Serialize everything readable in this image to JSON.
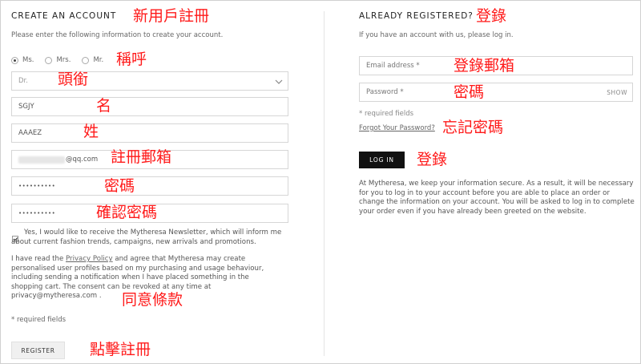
{
  "create": {
    "title": "CREATE AN ACCOUNT",
    "intro": "Please enter the following information to create your account.",
    "salutations": [
      {
        "label": "Ms.",
        "checked": true
      },
      {
        "label": "Mrs.",
        "checked": false
      },
      {
        "label": "Mr.",
        "checked": false
      }
    ],
    "title_select_value": "Dr.",
    "first_name_value": "SGJY",
    "last_name_value": "AAAEZ",
    "email_value_suffix": "@qq.com",
    "password_value": "••••••••••",
    "confirm_password_value": "••••••••••",
    "newsletter_checked": true,
    "newsletter_text": "Yes, I would like to receive the Mytheresa Newsletter, which will inform me about current fashion trends, campaigns, new arrivals and promotions.",
    "consent_prefix": "I have read the ",
    "privacy_link": "Privacy Policy",
    "consent_suffix": " and agree that Mytheresa may create personalised user profiles based on my purchasing and usage behaviour, including sending a notification when I have placed something in the shopping cart. The consent can be revoked at any time at privacy@mytheresa.com .",
    "required_note": "* required fields",
    "register_button": "REGISTER"
  },
  "login": {
    "title": "ALREADY REGISTERED?",
    "intro": "If you have an account with us, please log in.",
    "email_placeholder": "Email address *",
    "password_placeholder": "Password *",
    "show_label": "SHOW",
    "required_note": "* required fields",
    "forgot_link": "Forgot Your Password?",
    "login_button": "LOG IN",
    "secure_text": "At Mytheresa, we keep your information secure. As a result, it will be necessary for you to log in to your account before you are able to place an order or change the information on your account. You will be asked to log in to complete your order even if you have already been greeted on the website."
  },
  "annotations": {
    "new_account": "新用戶註冊",
    "salutation": "稱呼",
    "title": "頭銜",
    "first_name": "名",
    "last_name": "姓",
    "register_email": "註冊郵箱",
    "password": "密碼",
    "confirm_password": "確認密碼",
    "consent": "同意條款",
    "click_register": "點擊註冊",
    "login_heading": "登錄",
    "login_email": "登錄郵箱",
    "login_password": "密碼",
    "forgot_password": "忘記密碼",
    "login_button": "登錄"
  },
  "colors": {
    "annotation": "#ff1a1a",
    "login_button_bg": "#111111",
    "register_button_bg": "#f0f0f0"
  }
}
